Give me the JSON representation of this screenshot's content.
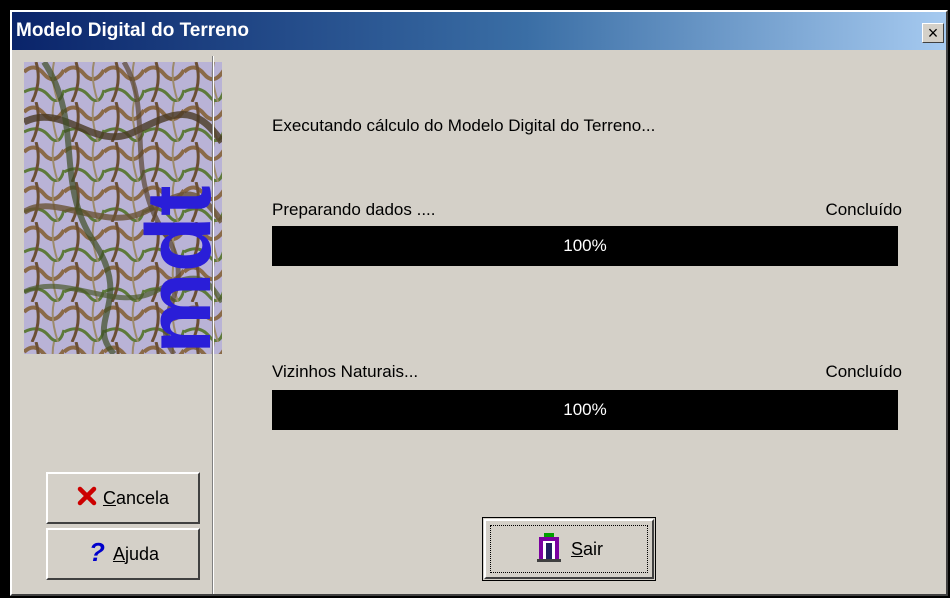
{
  "window": {
    "title": "Modelo Digital do Terreno",
    "close_glyph": "×"
  },
  "logo": {
    "text": "mdt",
    "icon": "terrain-map-image"
  },
  "sidebar": {
    "cancel": {
      "label": "Cancela",
      "mnemonic": "C",
      "rest": "ancela",
      "icon": "red-x-icon",
      "icon_color": "#cc0000"
    },
    "help": {
      "label": "Ajuda",
      "mnemonic": "A",
      "rest": "juda",
      "icon": "question-mark-icon",
      "icon_color": "#0000cc"
    }
  },
  "main": {
    "status": "Executando cálculo do Modelo Digital do Terreno...",
    "tasks": [
      {
        "label": "Preparando dados ....",
        "state": "Concluído",
        "progress_percent": 100,
        "progress_text": "100%"
      },
      {
        "label": "Vizinhos Naturais...",
        "state": "Concluído",
        "progress_percent": 100,
        "progress_text": "100%"
      }
    ],
    "exit": {
      "label": "Sair",
      "mnemonic": "S",
      "rest": "air",
      "icon": "exit-door-icon"
    }
  }
}
